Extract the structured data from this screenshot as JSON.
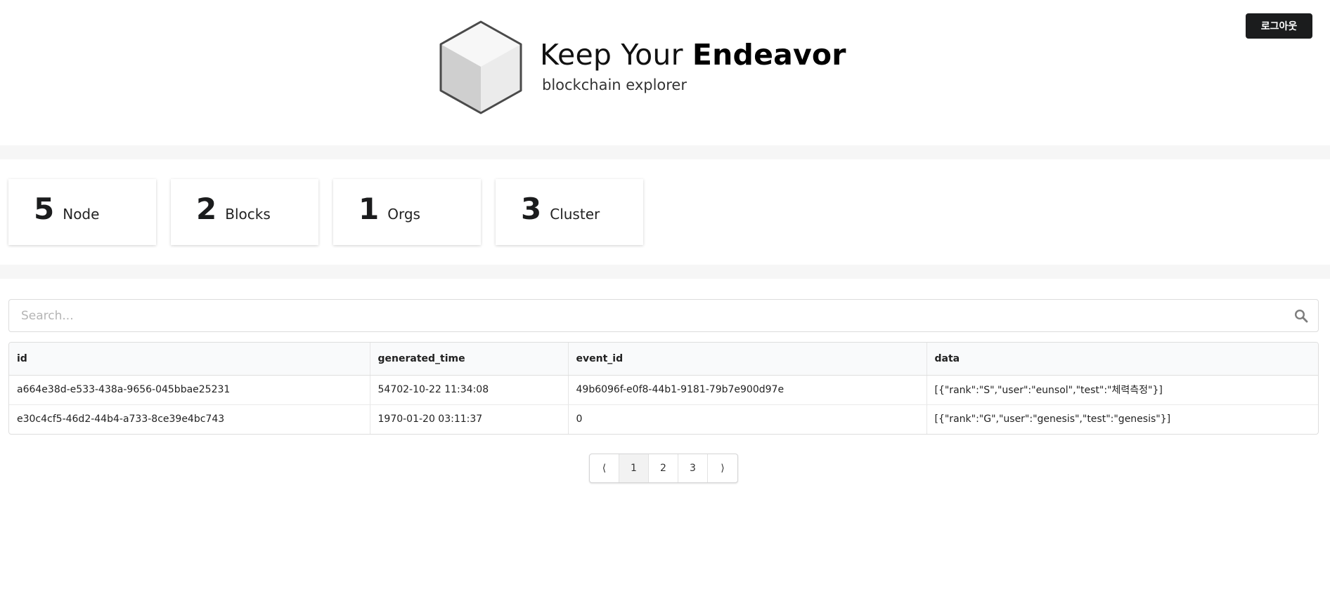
{
  "header": {
    "logout_label": "로그아웃",
    "brand_title_light": "Keep Your ",
    "brand_title_bold": "Endeavor",
    "brand_subtitle": "blockchain explorer"
  },
  "stats": [
    {
      "value": "5",
      "label": "Node"
    },
    {
      "value": "2",
      "label": "Blocks"
    },
    {
      "value": "1",
      "label": "Orgs"
    },
    {
      "value": "3",
      "label": "Cluster"
    }
  ],
  "search": {
    "placeholder": "Search...",
    "value": ""
  },
  "table": {
    "columns": [
      "id",
      "generated_time",
      "event_id",
      "data"
    ],
    "rows": [
      [
        "a664e38d-e533-438a-9656-045bbae25231",
        "54702-10-22 11:34:08",
        "49b6096f-e0f8-44b1-9181-79b7e900d97e",
        "[{\"rank\":\"S\",\"user\":\"eunsol\",\"test\":\"체력측정\"}]"
      ],
      [
        "e30c4cf5-46d2-44b4-a733-8ce39e4bc743",
        "1970-01-20 03:11:37",
        "0",
        "[{\"rank\":\"G\",\"user\":\"genesis\",\"test\":\"genesis\"}]"
      ]
    ]
  },
  "pagination": {
    "prev": "⟨",
    "pages": [
      "1",
      "2",
      "3"
    ],
    "next": "⟩",
    "current": "1"
  },
  "colors": {
    "button_bg": "#1b1c1d",
    "band_bg": "#f6f6f6",
    "header_row_bg": "#f9fafb",
    "active_page_bg": "#f2f2f2"
  }
}
